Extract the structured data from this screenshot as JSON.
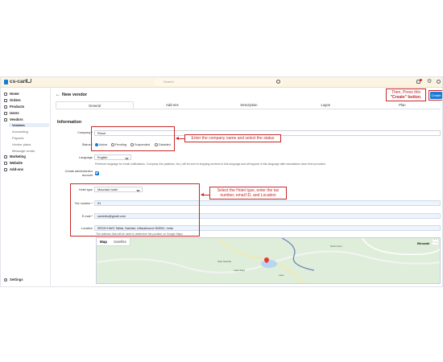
{
  "app": {
    "brand": "cs-cart",
    "search_placeholder": "Search"
  },
  "sidebar": {
    "items": [
      {
        "label": "Home",
        "icon": "home-icon"
      },
      {
        "label": "Orders",
        "icon": "orders-icon"
      },
      {
        "label": "Products",
        "icon": "products-icon"
      },
      {
        "label": "Users",
        "icon": "users-icon"
      },
      {
        "label": "Vendors",
        "icon": "vendors-icon"
      },
      {
        "label": "Marketing",
        "icon": "marketing-icon"
      },
      {
        "label": "Website",
        "icon": "website-icon"
      },
      {
        "label": "Add-ons",
        "icon": "addons-icon"
      }
    ],
    "vendor_subitems": [
      "Vendors",
      "Accounting",
      "Payouts",
      "Vendor plans",
      "Message center"
    ],
    "settings": "Settings"
  },
  "page": {
    "back": "←",
    "title": "New vendor",
    "create_button": "Create"
  },
  "tabs": [
    "General",
    "Add-ons",
    "Description",
    "Logos",
    "Plan"
  ],
  "form": {
    "section": "Information",
    "company_label": "Company *",
    "company_value": "Resot",
    "status_label": "Status *",
    "status_options": [
      "Active",
      "Pending",
      "Suspended",
      "Disabled"
    ],
    "language_label": "Language",
    "language_value": "English",
    "language_help": "Preferred language for email notifications. Company info (address, etc.) will be sent to shipping services in this language and will appear in this language after translations have been provided.",
    "admin_label_1": "Create administrator",
    "admin_label_2": "account",
    "hotel_type_label": "Hotel type",
    "hotel_type_value": "Mountain hotel",
    "tax_label": "Tax number *",
    "tax_value": "91",
    "email_label": "E-mail *",
    "email_value": "sweetes@gmail.com",
    "location_label": "Location",
    "location_value": "9RG9+HWG Talltal, Nainital, Uttarakhand 263002, India",
    "location_help": "The address that will be used to determine the position on Google Maps"
  },
  "map": {
    "tabs": [
      "Map",
      "Satellite"
    ],
    "labels": [
      "Bhowali",
      "Saat Nainital",
      "Lake",
      "Naina Devi",
      "Lalla Wala"
    ]
  },
  "annotations": {
    "company": "Enter the company name and select the status",
    "hotel": "Select the Hotel type, enter the tax number, email ID, and Location",
    "create_1": "Then, Press this",
    "create_2": "\"Create\" button."
  },
  "colors": {
    "accent": "#1c7bd6",
    "annotation": "#c62828",
    "topbar": "#fcf4e3"
  }
}
